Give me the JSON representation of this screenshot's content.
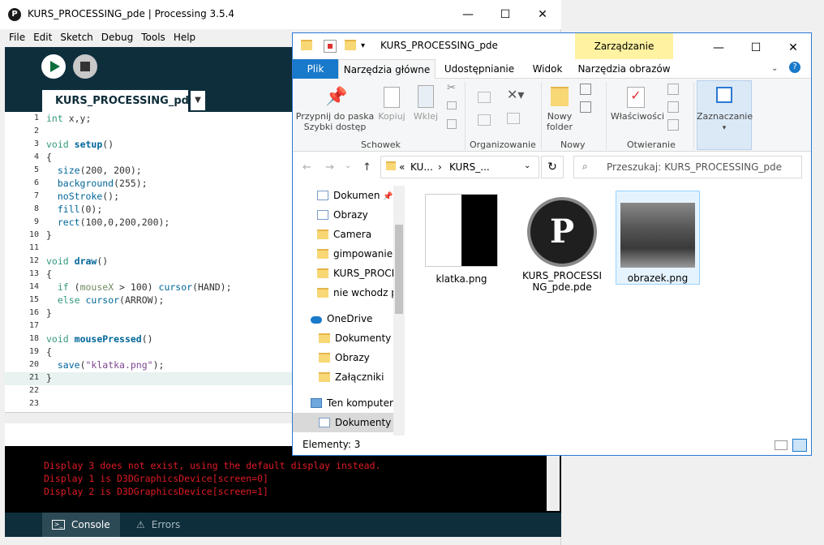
{
  "processing": {
    "title": "KURS_PROCESSING_pde | Processing 3.5.4",
    "menu": [
      "File",
      "Edit",
      "Sketch",
      "Debug",
      "Tools",
      "Help"
    ],
    "tab": "KURS_PROCESSING_pde",
    "line_numbers": [
      "1",
      "2",
      "3",
      "4",
      "5",
      "6",
      "7",
      "8",
      "9",
      "10",
      "11",
      "12",
      "13",
      "14",
      "15",
      "16",
      "17",
      "18",
      "19",
      "20",
      "21",
      "22",
      "23"
    ],
    "console_lines": [
      "Display 3 does not exist, using the default display instead.",
      "Display 1 is D3DGraphicsDevice[screen=0]",
      "Display 2 is D3DGraphicsDevice[screen=1]"
    ],
    "console_tab": "Console",
    "errors_tab": "Errors",
    "colors": {
      "toolbar": "#0e2e3c",
      "error_text": "#e01b24",
      "keyword": "#33997e",
      "function": "#006699"
    }
  },
  "explorer": {
    "title": "KURS_PROCESSING_pde",
    "context_tab": "Zarządzanie",
    "tabs": [
      "Plik",
      "Narzędzia główne",
      "Udostępnianie",
      "Widok",
      "Narzędzia obrazów"
    ],
    "ribbon": {
      "pin_line1": "Przypnij do paska",
      "pin_line2": "Szybki dostęp",
      "copy": "Kopiuj",
      "paste": "Wklej",
      "new_folder_line1": "Nowy",
      "new_folder_line2": "folder",
      "properties": "Właściwości",
      "select": "Zaznaczanie",
      "groups": [
        "Schowek",
        "Organizowanie",
        "Nowy",
        "Otwieranie"
      ]
    },
    "address": {
      "chevron": "«",
      "crumb1": "KU...",
      "crumb2": "KURS_..."
    },
    "search_placeholder": "Przeszukaj: KURS_PROCESSING_pde",
    "nav": {
      "quick": [
        "Dokumen",
        "Obrazy",
        "Camera",
        "gimpowanie",
        "KURS_PROCE",
        "nie wchodz p"
      ],
      "onedrive": "OneDrive",
      "onedrive_items": [
        "Dokumenty",
        "Obrazy",
        "Załączniki"
      ],
      "this_pc": "Ten komputer",
      "this_pc_items": [
        "Dokumenty"
      ]
    },
    "files": [
      {
        "name": "klatka.png"
      },
      {
        "name_line1": "KURS_PROCESSI",
        "name_line2": "NG_pde.pde"
      },
      {
        "name": "obrazek.png"
      }
    ],
    "status": "Elementy: 3",
    "colors": {
      "accent": "#1979ca",
      "context": "#fff2a0"
    }
  }
}
